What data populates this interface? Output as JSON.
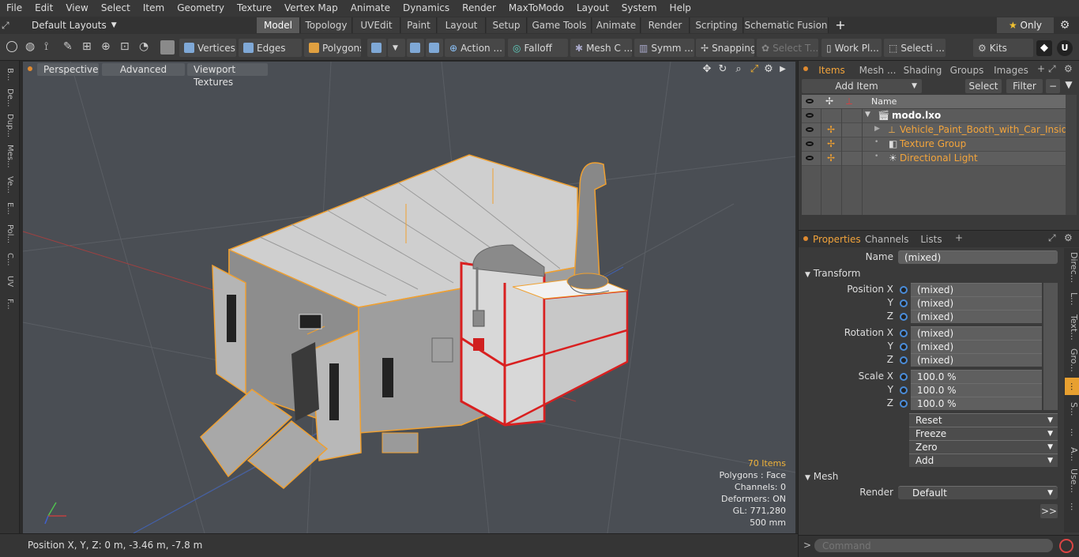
{
  "menubar": {
    "items": [
      "File",
      "Edit",
      "View",
      "Select",
      "Item",
      "Geometry",
      "Texture",
      "Vertex Map",
      "Animate",
      "Dynamics",
      "Render",
      "MaxToModo",
      "Layout",
      "System",
      "Help"
    ]
  },
  "tabbar": {
    "layout_label": "Default Layouts",
    "tabs": [
      "Model",
      "Topology",
      "UVEdit",
      "Paint",
      "Layout",
      "Setup",
      "Game Tools",
      "Animate",
      "Render",
      "Scripting",
      "Schematic Fusion"
    ],
    "active_tab": "Model",
    "add_icon": "+",
    "only_label": "Only"
  },
  "toolbar": {
    "vertices": "Vertices",
    "edges": "Edges",
    "polygons": "Polygons",
    "action": "Action ...",
    "falloff": "Falloff",
    "mesh": "Mesh C ...",
    "symm": "Symm ...",
    "snapping": "Snapping",
    "select_t": "Select T...",
    "work_plane": "Work Pl...",
    "selection": "Selecti ...",
    "kits": "Kits"
  },
  "left_tabs": [
    "B...",
    "De...",
    "Dup...",
    "Mes...",
    "Ve...",
    "E...",
    "Pol...",
    "C...",
    "UV",
    "F..."
  ],
  "viewport": {
    "perspective": "Perspective",
    "advanced": "Advanced",
    "textures": "Viewport Textures",
    "stats": {
      "items": "70 Items",
      "polygons": "Polygons : Face",
      "channels": "Channels: 0",
      "deformers": "Deformers: ON",
      "gl": "GL: 771,280",
      "scale": "500 mm"
    }
  },
  "statusbar": {
    "position": "Position X, Y, Z:   0 m, -3.46 m, -7.8 m"
  },
  "items_panel": {
    "tabs": [
      "Items",
      "Mesh ...",
      "Shading",
      "Groups",
      "Images"
    ],
    "add_item": "Add Item",
    "select": "Select",
    "filter": "Filter",
    "name_header": "Name",
    "rows": [
      {
        "label": "modo.lxo"
      },
      {
        "label": "Vehicle_Paint_Booth_with_Car_Inside"
      },
      {
        "label": "Texture Group"
      },
      {
        "label": "Directional Light"
      }
    ]
  },
  "properties": {
    "tabs": [
      "Properties",
      "Channels",
      "Lists"
    ],
    "name_label": "Name",
    "name_value": "(mixed)",
    "transform": "Transform",
    "position_label": "Position X",
    "rotation_label": "Rotation X",
    "scale_label": "Scale X",
    "y": "Y",
    "z": "Z",
    "mixed": "(mixed)",
    "scale_value": "100.0 %",
    "reset": "Reset",
    "freeze": "Freeze",
    "zero": "Zero",
    "add": "Add",
    "mesh_section": "Mesh",
    "render_label": "Render",
    "render_value": "Default",
    "more": ">>",
    "command_placeholder": "Command"
  },
  "right_vtabs": [
    "Direc...",
    "L...",
    "Text...",
    "Gro...",
    "...",
    "S...",
    "...",
    "A...",
    "Use...",
    "..."
  ],
  "colors": {
    "accent": "#f3a43b",
    "selection": "#f0a030",
    "red_frame": "#d92020"
  }
}
